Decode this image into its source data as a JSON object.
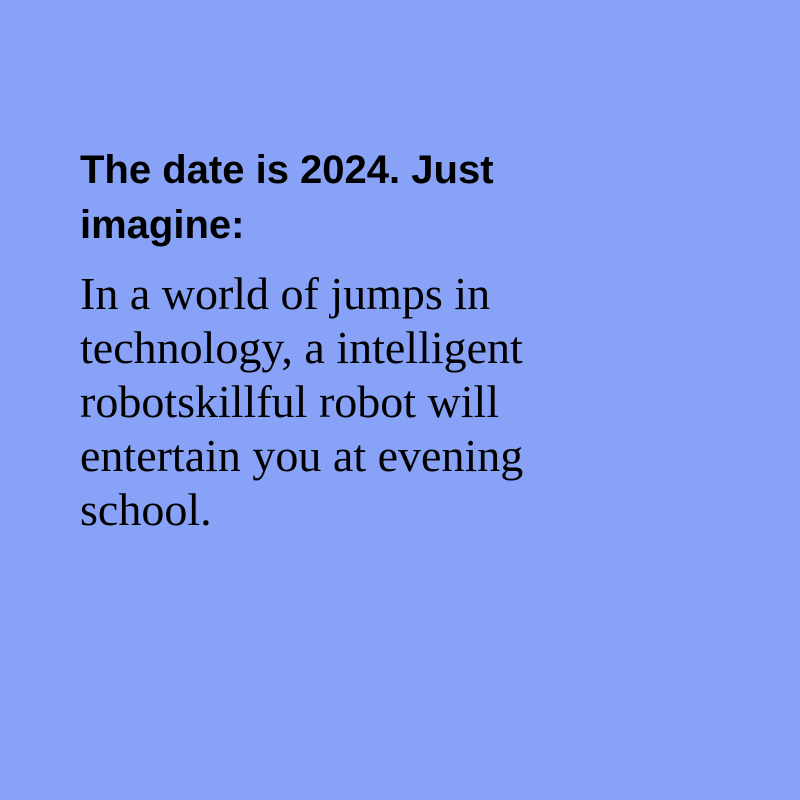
{
  "heading": "The date is 2024. Just\nimagine:",
  "body": "In a world of jumps in\ntechnology, a intelligent\nrobotskillful robot will\nentertain you at evening\nschool.",
  "colors": {
    "background": "#87a2f7",
    "text": "#000000"
  }
}
